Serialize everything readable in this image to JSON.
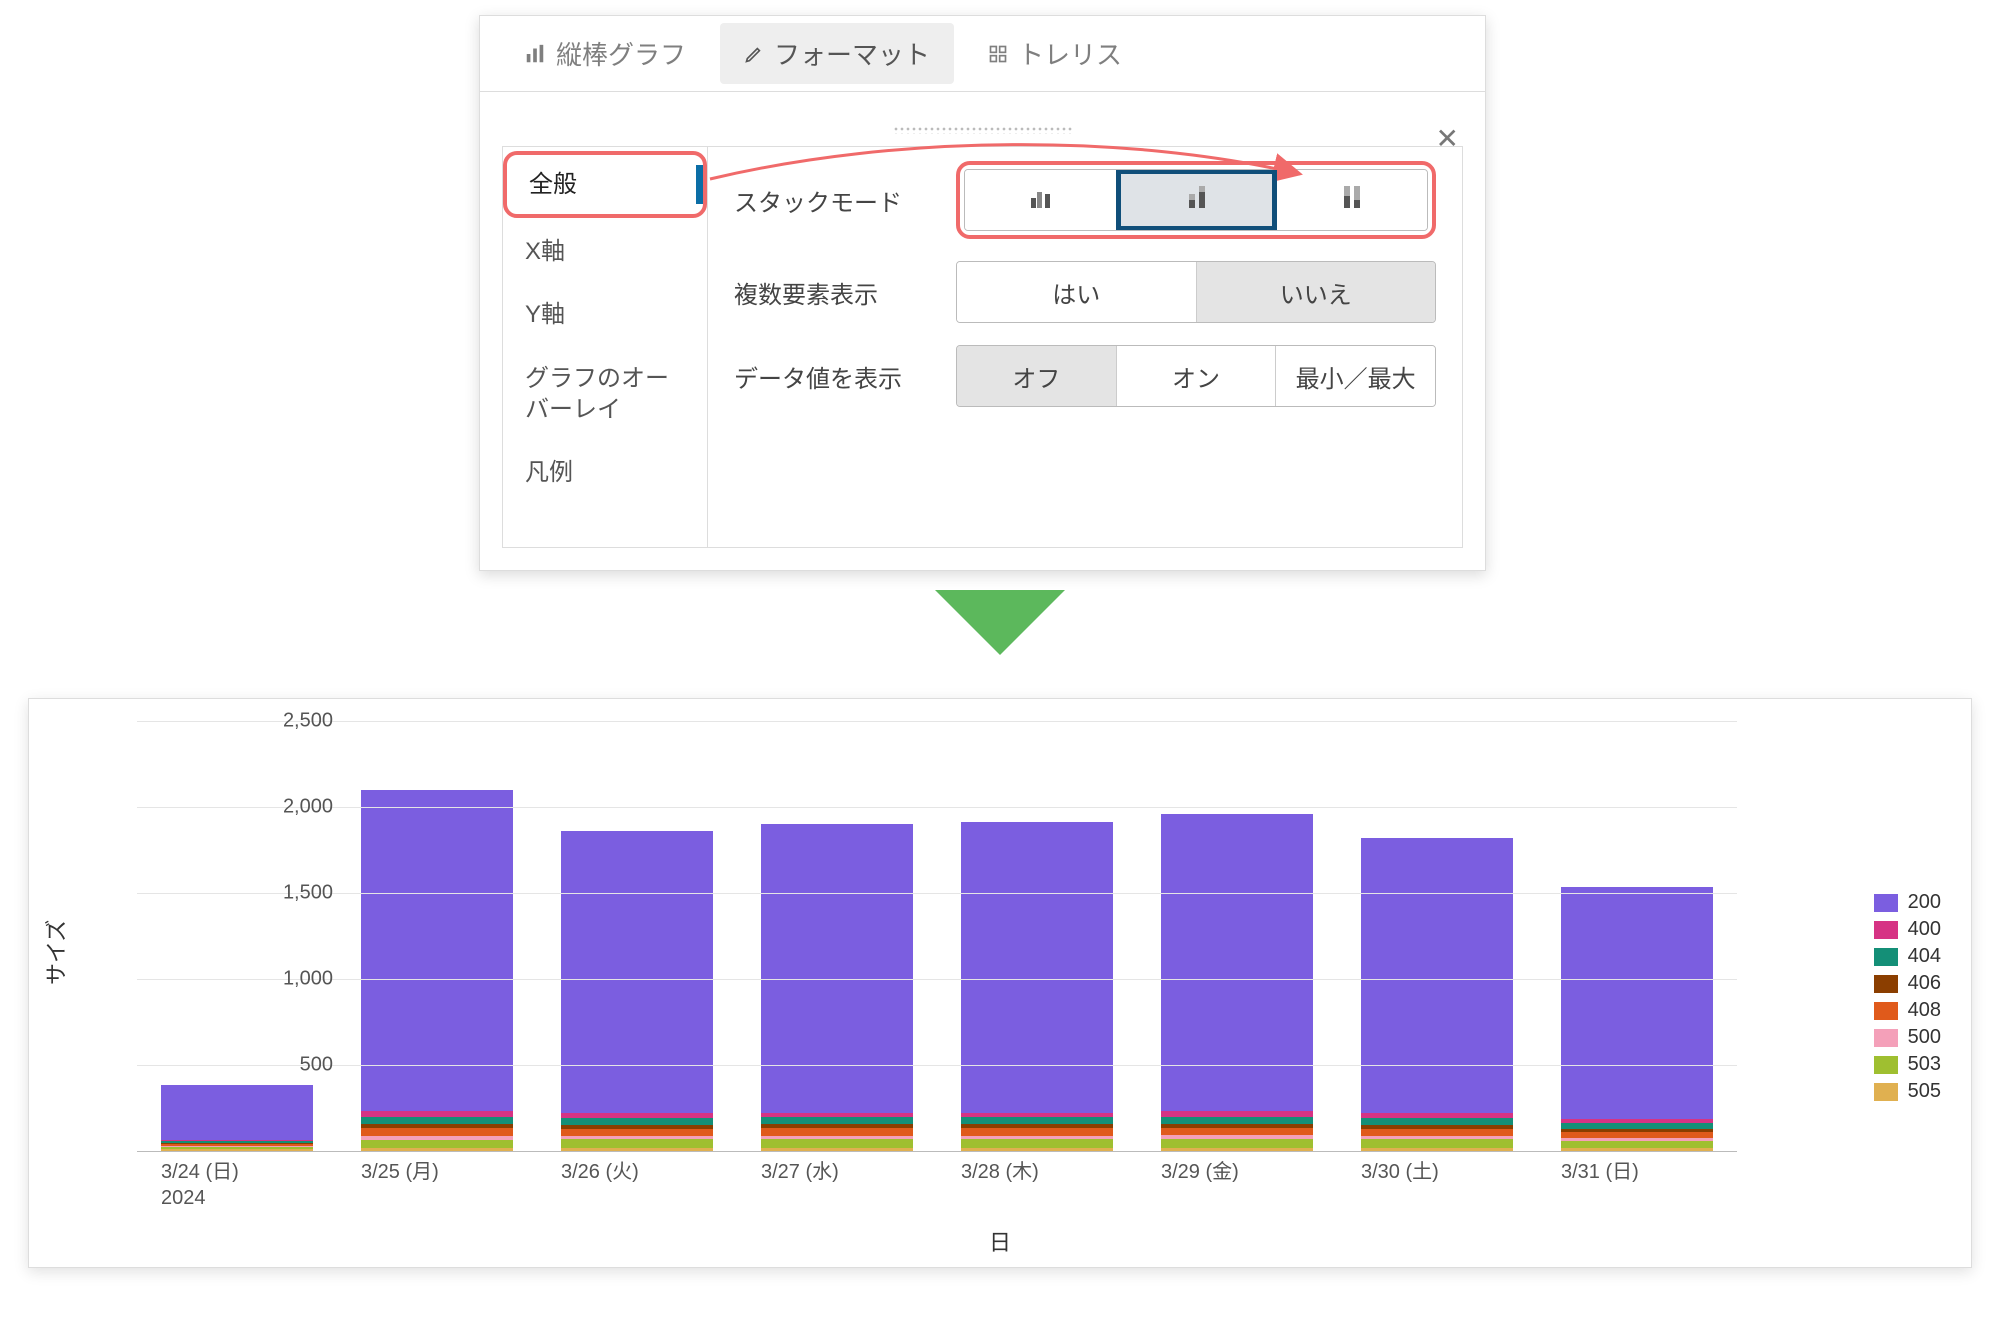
{
  "panel": {
    "tabs": {
      "bar": "縦棒グラフ",
      "format": "フォーマット",
      "trellis": "トレリス"
    },
    "close": "✕",
    "sidebar": {
      "general": "全般",
      "xaxis": "X軸",
      "yaxis": "Y軸",
      "overlay": "グラフのオーバーレイ",
      "legend": "凡例"
    },
    "rows": {
      "stack_mode": {
        "label": "スタックモード"
      },
      "multi_elem": {
        "label": "複数要素表示",
        "yes": "はい",
        "no": "いいえ"
      },
      "show_values": {
        "label": "データ値を表示",
        "off": "オフ",
        "on": "オン",
        "minmax": "最小／最大"
      }
    }
  },
  "chart_data": {
    "type": "bar",
    "stacked": true,
    "xlabel": "日",
    "ylabel": "サイズ",
    "ylim": [
      0,
      2500
    ],
    "yticks": [
      0,
      500,
      1000,
      1500,
      2000,
      2500
    ],
    "ytick_labels": [
      "",
      "500",
      "1,000",
      "1,500",
      "2,000",
      "2,500"
    ],
    "categories": [
      "3/24 (日)\n2024",
      "3/25 (月)",
      "3/26 (火)",
      "3/27 (水)",
      "3/28 (木)",
      "3/29 (金)",
      "3/30 (土)",
      "3/31 (日)"
    ],
    "series": [
      {
        "name": "200",
        "color": "#7b5ee0",
        "values": [
          320,
          1870,
          1640,
          1680,
          1690,
          1730,
          1600,
          1350
        ]
      },
      {
        "name": "400",
        "color": "#d63384",
        "values": [
          8,
          30,
          28,
          28,
          28,
          30,
          28,
          24
        ]
      },
      {
        "name": "404",
        "color": "#148f77",
        "values": [
          10,
          40,
          38,
          40,
          40,
          40,
          38,
          32
        ]
      },
      {
        "name": "406",
        "color": "#8b3e00",
        "values": [
          6,
          26,
          24,
          24,
          24,
          26,
          24,
          20
        ]
      },
      {
        "name": "408",
        "color": "#e05a1b",
        "values": [
          10,
          45,
          40,
          42,
          42,
          42,
          40,
          34
        ]
      },
      {
        "name": "500",
        "color": "#f4a0b9",
        "values": [
          6,
          24,
          22,
          22,
          22,
          24,
          22,
          18
        ]
      },
      {
        "name": "503",
        "color": "#9fbf30",
        "values": [
          10,
          45,
          48,
          48,
          48,
          48,
          48,
          40
        ]
      },
      {
        "name": "505",
        "color": "#e0b050",
        "values": [
          14,
          20,
          20,
          20,
          20,
          20,
          20,
          18
        ]
      }
    ]
  }
}
